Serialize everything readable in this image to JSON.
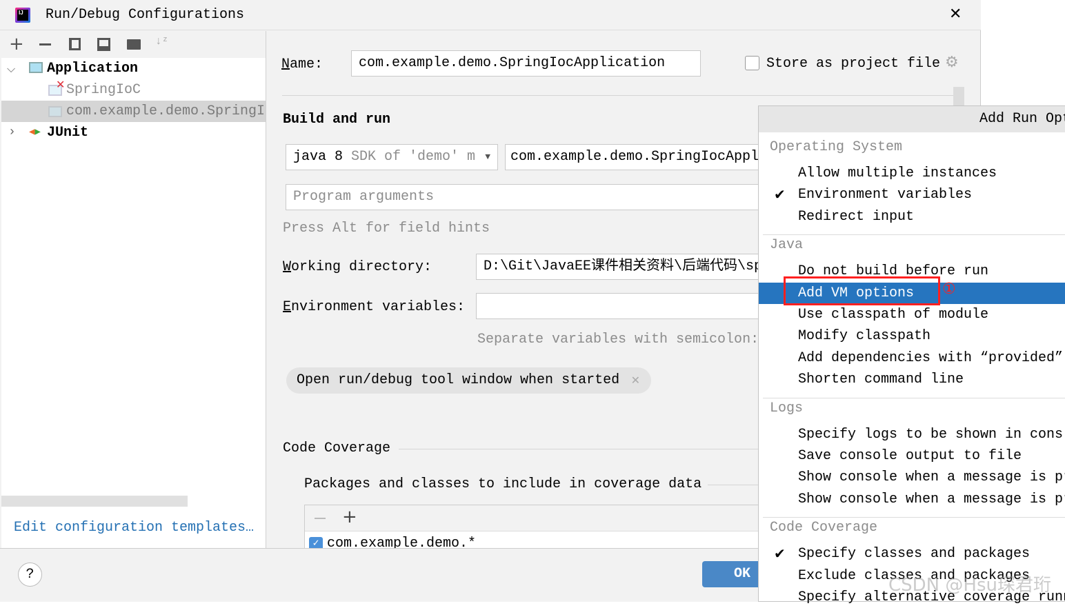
{
  "window": {
    "title": "Run/Debug Configurations",
    "close_icon": "close-icon"
  },
  "toolbar": {
    "icons": [
      "plus-icon",
      "minus-icon",
      "copy-icon",
      "save-icon",
      "new-folder-icon",
      "sort-az-icon"
    ]
  },
  "tree": {
    "items": [
      {
        "label": "Application",
        "expanded": true
      },
      {
        "label": "SpringIoC",
        "error": true
      },
      {
        "label": "com.example.demo.SpringI",
        "selected": true
      },
      {
        "label": "JUnit",
        "expanded": false
      }
    ]
  },
  "left_footer": {
    "edit_templates": "Edit configuration templates…"
  },
  "form": {
    "name_label": "Name:",
    "name_value": "com.example.demo.SpringIocApplication",
    "store_label": "Store as project file",
    "store_checked": false,
    "build_and_run": "Build and run",
    "sdk_main": "java 8",
    "sdk_detail": "SDK of 'demo' m",
    "main_class": "com.example.demo.SpringIocAppl",
    "program_args_placeholder": "Program arguments",
    "hint": "Press Alt for field hints",
    "working_dir_label": "Working directory:",
    "working_dir_value": "D:\\Git\\JavaEE课件相关资料\\后端代码\\sp",
    "env_label": "Environment variables:",
    "env_value": "",
    "env_hint": "Separate variables with semicolon:",
    "open_tool_window_chip": "Open run/debug tool window when started",
    "code_coverage": "Code Coverage",
    "packages_label": "Packages and classes to include in coverage data",
    "coverage_entries": [
      {
        "pattern": "com.example.demo.*",
        "checked": true
      }
    ]
  },
  "buttons": {
    "ok": "OK",
    "help": "?"
  },
  "popup": {
    "title": "Add Run Opt",
    "groups": [
      {
        "name": "Operating System",
        "items": [
          {
            "label": "Allow multiple instances",
            "checked": false
          },
          {
            "label": "Environment variables",
            "checked": true
          },
          {
            "label": "Redirect input",
            "checked": false
          }
        ]
      },
      {
        "name": "Java",
        "items": [
          {
            "label": "Do not build before run",
            "checked": false
          },
          {
            "label": "Add VM options",
            "checked": false,
            "highlighted": true
          },
          {
            "label": "Use classpath of module",
            "checked": false
          },
          {
            "label": "Modify classpath",
            "checked": false
          },
          {
            "label": "Add dependencies with “provided”",
            "checked": false
          },
          {
            "label": "Shorten command line",
            "checked": false
          }
        ]
      },
      {
        "name": "Logs",
        "items": [
          {
            "label": "Specify logs to be shown in cons",
            "checked": false
          },
          {
            "label": "Save console output to file",
            "checked": false
          },
          {
            "label": "Show console when a message is pr",
            "checked": false
          },
          {
            "label": "Show console when a message is pr",
            "checked": false
          }
        ]
      },
      {
        "name": "Code Coverage",
        "items": [
          {
            "label": "Specify classes and packages",
            "checked": true
          },
          {
            "label": "Exclude classes and packages",
            "checked": false
          },
          {
            "label": "Specify alternative coverage runn",
            "checked": false
          }
        ]
      }
    ]
  },
  "annotation": {
    "marker": "①",
    "color": "#ff2020"
  },
  "watermark": "CSDN @Hsu琛君珩",
  "colors": {
    "selection": "#2675bf",
    "link": "#2470b3",
    "ok_button": "#4a88c7"
  }
}
